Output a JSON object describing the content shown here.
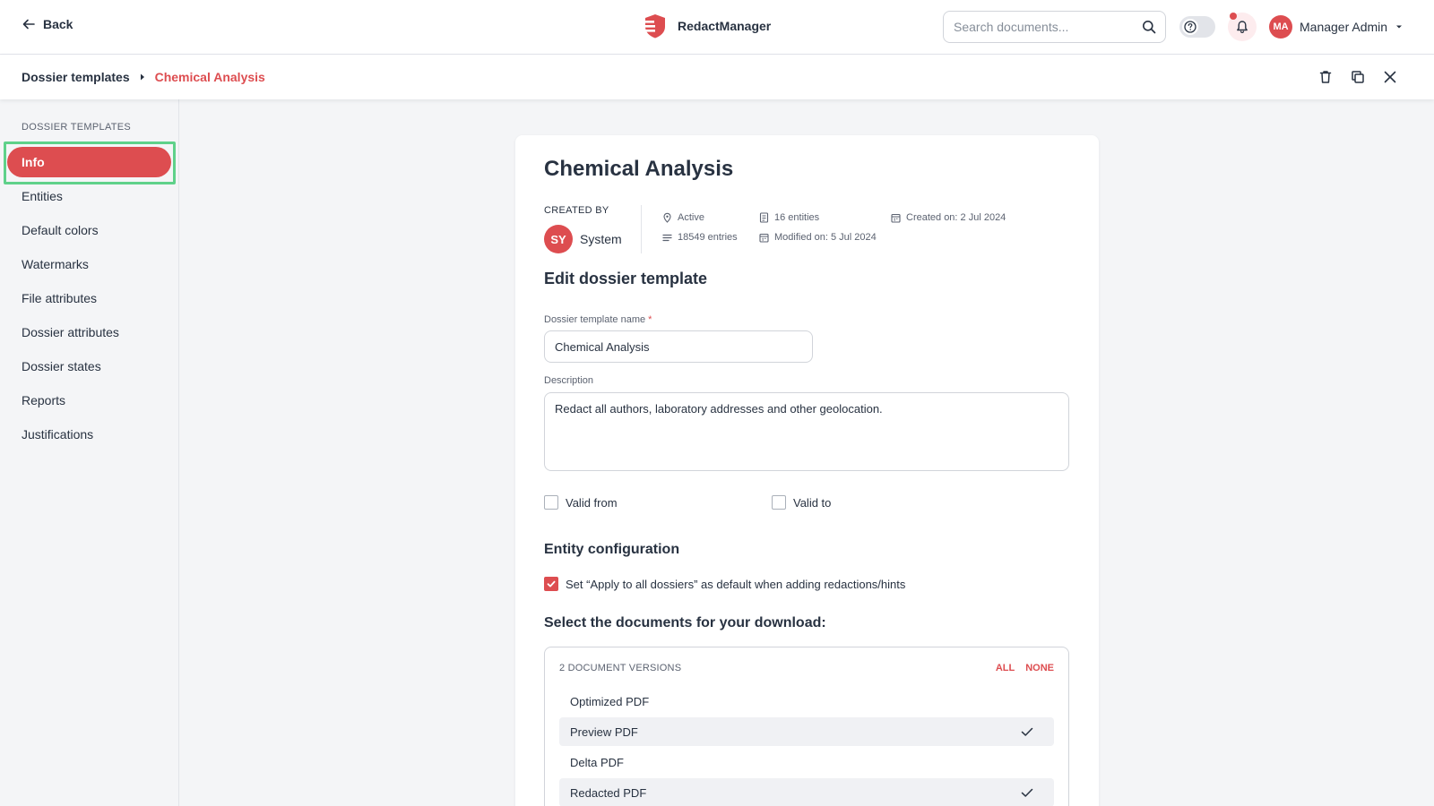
{
  "header": {
    "back_label": "Back",
    "app_name": "RedactManager",
    "search_placeholder": "Search documents...",
    "user_initials": "MA",
    "user_name": "Manager Admin"
  },
  "breadcrumb": {
    "root": "Dossier templates",
    "current": "Chemical Analysis"
  },
  "sidebar": {
    "title": "DOSSIER TEMPLATES",
    "items": [
      {
        "label": "Info",
        "active": true
      },
      {
        "label": "Entities"
      },
      {
        "label": "Default colors"
      },
      {
        "label": "Watermarks"
      },
      {
        "label": "File attributes"
      },
      {
        "label": "Dossier attributes"
      },
      {
        "label": "Dossier states"
      },
      {
        "label": "Reports"
      },
      {
        "label": "Justifications"
      }
    ]
  },
  "template": {
    "title": "Chemical Analysis",
    "created_by_label": "CREATED BY",
    "creator_initials": "SY",
    "creator_name": "System",
    "stats": {
      "status": "Active",
      "entries": "18549 entries",
      "entities": "16 entities",
      "modified": "Modified on: 5 Jul 2024",
      "created": "Created on: 2 Jul 2024"
    }
  },
  "form": {
    "section_title": "Edit dossier template",
    "name_label": "Dossier template name",
    "name_required_mark": "*",
    "name_value": "Chemical Analysis",
    "description_label": "Description",
    "description_value": "Redact all authors, laboratory addresses and other geolocation.",
    "valid_from_label": "Valid from",
    "valid_to_label": "Valid to",
    "entity_section_title": "Entity configuration",
    "apply_all_label": "Set “Apply to all dossiers” as default when adding redactions/hints",
    "apply_all_checked": true
  },
  "download": {
    "title": "Select the documents for your download:",
    "count_label": "2 DOCUMENT VERSIONS",
    "all_label": "ALL",
    "none_label": "NONE",
    "options": [
      {
        "label": "Optimized PDF",
        "selected": false
      },
      {
        "label": "Preview PDF",
        "selected": true
      },
      {
        "label": "Delta PDF",
        "selected": false
      },
      {
        "label": "Redacted PDF",
        "selected": true
      }
    ]
  },
  "colors": {
    "accent": "#dd4d50",
    "focus_ring": "#5fd18a",
    "text": "#283241",
    "background": "#f4f5f7"
  },
  "icons": [
    "arrow-left-icon",
    "logo-icon",
    "search-icon",
    "help-icon",
    "bell-icon",
    "chevron-down-icon",
    "trash-icon",
    "copy-icon",
    "close-icon",
    "location-pin-icon",
    "list-icon",
    "entities-icon",
    "calendar-icon",
    "checkmark-icon"
  ]
}
